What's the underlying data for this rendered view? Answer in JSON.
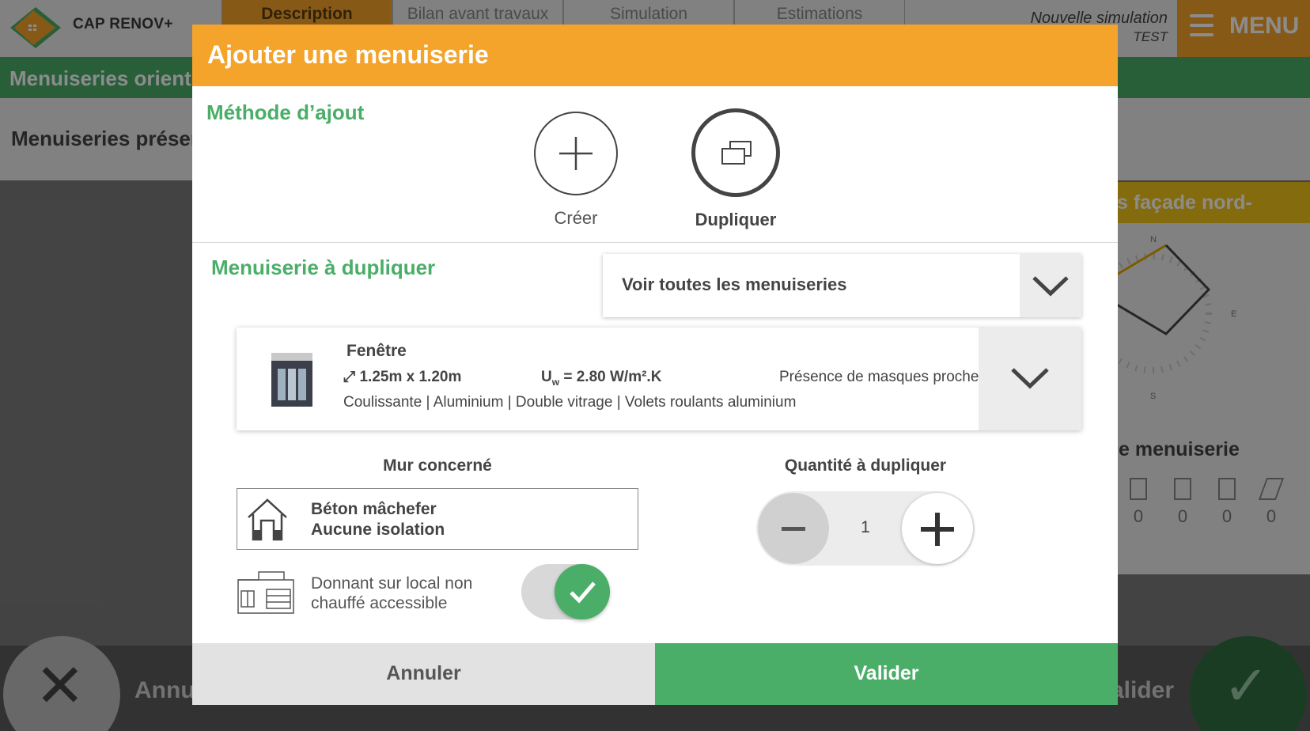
{
  "app": {
    "brand": "CAP RENOV+",
    "tabs": [
      "Description",
      "Bilan avant travaux",
      "Simulation",
      "Estimations"
    ],
    "simulation_title": "Nouvelle simulation",
    "simulation_name": "TEST",
    "menu_label": "MENU"
  },
  "background": {
    "green_bar": "Menuiseries orientées",
    "panel_title": "Menuiseries présentes",
    "right_header": "s façade nord-",
    "right_subtitle": "e menuiserie",
    "compass": {
      "n": "N",
      "e": "E",
      "s": "S"
    },
    "counters": [
      "0",
      "0",
      "0",
      "0"
    ],
    "cancel_label": "Annu",
    "valid_label": "alider"
  },
  "modal": {
    "title": "Ajouter une menuiserie",
    "method_label": "Méthode d’ajout",
    "methods": {
      "create": "Créer",
      "duplicate": "Dupliquer"
    },
    "duplicate_label": "Menuiserie à dupliquer",
    "select_value": "Voir toutes les menuiseries",
    "item": {
      "type": "Fenêtre",
      "dimensions": "1.25m x 1.20m",
      "u_label": "U",
      "u_sub": "w",
      "u_value": "= 2.80 W/m².K",
      "masks": "Présence de masques proches",
      "specs": "Coulissante | Aluminium | Double vitrage | Volets roulants aluminium"
    },
    "wall_title": "Mur concerné",
    "wall": {
      "line1": "Béton mâchefer",
      "line2": "Aucune isolation"
    },
    "local": {
      "line1": "Donnant sur local non",
      "line2": "chauffé accessible",
      "checked": true
    },
    "quantity_title": "Quantité à dupliquer",
    "quantity": "1",
    "cancel": "Annuler",
    "validate": "Valider"
  },
  "colors": {
    "accent": "#f4a32b",
    "green": "#4aae68",
    "yellow": "#f0c419"
  }
}
